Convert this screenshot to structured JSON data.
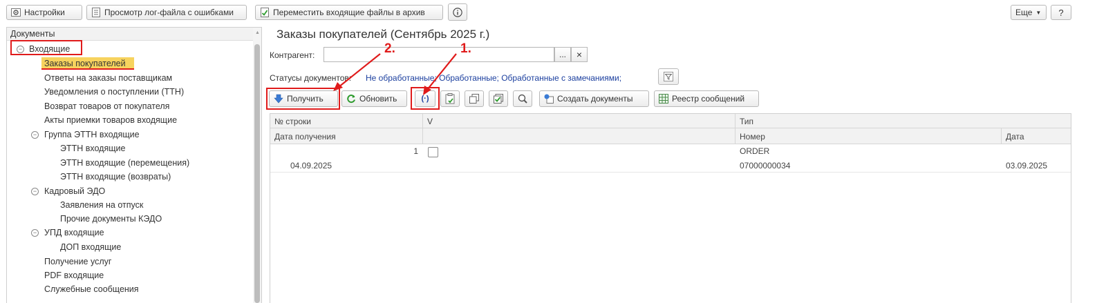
{
  "toolbar": {
    "settings_label": "Настройки",
    "log_label": "Просмотр лог-файла с ошибками",
    "archive_label": "Переместить входящие файлы в архив",
    "more_label": "Еще",
    "help_label": "?"
  },
  "tree": {
    "header": "Документы",
    "incoming": "Входящие",
    "items": [
      "Заказы покупателей",
      "Ответы на заказы поставщикам",
      "Уведомления о поступлении (ТТН)",
      "Возврат товаров от покупателя",
      "Акты приемки товаров входящие"
    ],
    "group_ettn": "Группа ЭТТН входящие",
    "ettn_items": [
      "ЭТТН входящие",
      "ЭТТН входящие (перемещения)",
      "ЭТТН входящие (возвраты)"
    ],
    "group_hr": "Кадровый ЭДО",
    "hr_items": [
      "Заявления на отпуск",
      "Прочие документы КЭДО"
    ],
    "group_upd": "УПД входящие",
    "upd_items": [
      "ДОП входящие"
    ],
    "tail_items": [
      "Получение услуг",
      "PDF входящие",
      "Служебные сообщения"
    ]
  },
  "main": {
    "title": "Заказы покупателей (Сентябрь 2025 г.)",
    "counterparty_label": "Контрагент:",
    "counterparty_value": "",
    "select_btn": "...",
    "clear_btn": "×",
    "statuses_label": "Статусы документов:",
    "statuses_value": "Не обработанные; Обработанные; Обработанные с замечаниями;",
    "receive_btn": "Получить",
    "refresh_btn": "Обновить",
    "create_docs_btn": "Создать документы",
    "registry_btn": "Реестр сообщений"
  },
  "annotations": {
    "one": "1.",
    "two": "2."
  },
  "table": {
    "col_row_no": "№ строки",
    "col_v": "V",
    "col_type": "Тип",
    "col_received": "Дата получения",
    "col_number": "Номер",
    "col_date": "Дата",
    "rows": [
      {
        "row_no": "1",
        "received": "04.09.2025",
        "type": "ORDER",
        "number": "07000000034",
        "date": "03.09.2025"
      }
    ]
  },
  "colors": {
    "accent_red": "#e01b1b",
    "highlight": "#f7d35e",
    "link": "#1a3e9e"
  }
}
